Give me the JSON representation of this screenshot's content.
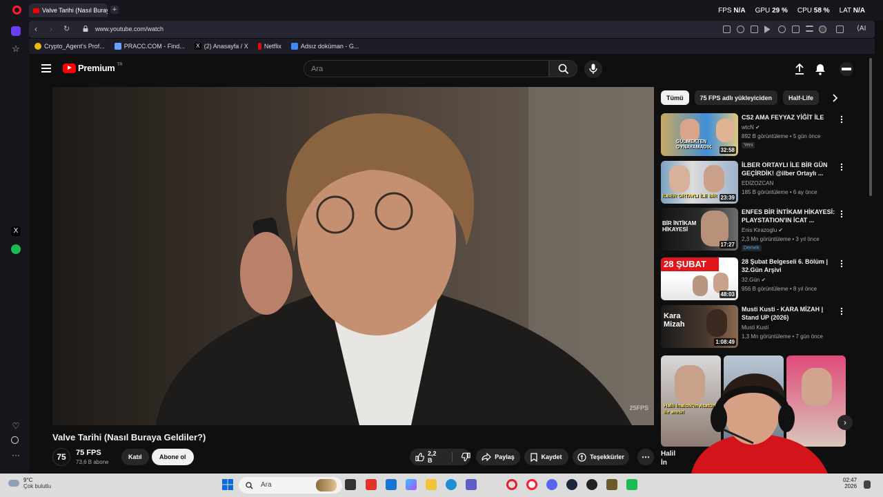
{
  "browser": {
    "tab_title": "Valve Tarihi (Nasıl Buraya",
    "url": "www.youtube.com/watch",
    "perf": {
      "fps_label": "FPS",
      "fps_value": "N/A",
      "gpu_label": "GPU",
      "gpu_value": "29 %",
      "cpu_label": "CPU",
      "cpu_value": "58 %",
      "lat_label": "LAT",
      "lat_value": "N/A"
    },
    "ai_label": "AI",
    "bookmarks": [
      {
        "label": "Crypto_Agent's Prof...",
        "color": "#f0b90b"
      },
      {
        "label": "PRACC.COM - Find...",
        "color": "#6aa0ff"
      },
      {
        "label": "(2) Anasayfa / X",
        "color": "#ffffff"
      },
      {
        "label": "Netflix",
        "color": "#e50914"
      },
      {
        "label": "Adsız doküman - G...",
        "color": "#4285f4"
      }
    ]
  },
  "youtube": {
    "logo_text": "Premium",
    "logo_region": "TR",
    "search_placeholder": "Ara",
    "video": {
      "title": "Valve Tarihi (Nasıl Buraya Geldiler?)",
      "watermark": "25FPS",
      "channel_name": "75 FPS",
      "channel_avatar": "75",
      "subscribers": "73,6 B abone",
      "join_label": "Katıl",
      "subscribe_label": "Abone ol",
      "likes": "2,2 B",
      "share_label": "Paylaş",
      "save_label": "Kaydet",
      "thanks_label": "Teşekkürler"
    },
    "chips": [
      "Tümü",
      "75 FPS adlı yükleyiciden",
      "Half-Life"
    ],
    "related": [
      {
        "title": "CS2 AMA FEYYAZ YİĞİT İLE",
        "channel": "wtcN",
        "meta": "892 B görüntüleme • 5 gün önce",
        "badge": "Yeni",
        "duration": "32:58",
        "thumb_text": "GÜLMEKTEN OYNAYAMADIK"
      },
      {
        "title": "İLBER ORTAYLI İLE BİR GÜN GEÇİRDİK! @ilber Ortaylı ...",
        "channel": "EDİZOZCAN",
        "meta": "185 B görüntüleme • 6 ay önce",
        "badge": "",
        "duration": "23:39",
        "thumb_text": "İLBER ORTAYLI İLE BİR"
      },
      {
        "title": "ENFES BİR İNTİKAM HİKAYESİ: PLAYSTATION'IN İCAT ...",
        "channel": "Enis Kirazoglu",
        "meta": "2,3 Mn görüntüleme • 3 yıl önce",
        "badge": "Dernek",
        "duration": "17:27",
        "thumb_text": "BİR İNTİKAM HİKAYESİ"
      },
      {
        "title": "28 Şubat Belgeseli 6. Bölüm | 32.Gün Arşivi",
        "channel": "32.Gün",
        "meta": "956 B görüntüleme • 8 yıl önce",
        "badge": "",
        "duration": "48:03",
        "thumb_text": "28 ŞUBAT"
      },
      {
        "title": "Musti Kusti - KARA MİZAH | Stand UP (2026)",
        "channel": "Musti Kusti",
        "meta": "1,3 Mn görüntüleme • 7 gün önce",
        "badge": "",
        "duration": "1:08:49",
        "thumb_text": "Kara Mizah"
      }
    ],
    "shorts": [
      {
        "caption": "Halli İnalcık'ın Atatürk ile anısı!"
      },
      {
        "caption": "Halil"
      }
    ],
    "shorts_caption_2": "İn"
  },
  "taskbar": {
    "temp": "9°C",
    "weather": "Çok bulutlu",
    "search_placeholder": "Ara",
    "time": "02:47",
    "date": "2026"
  }
}
